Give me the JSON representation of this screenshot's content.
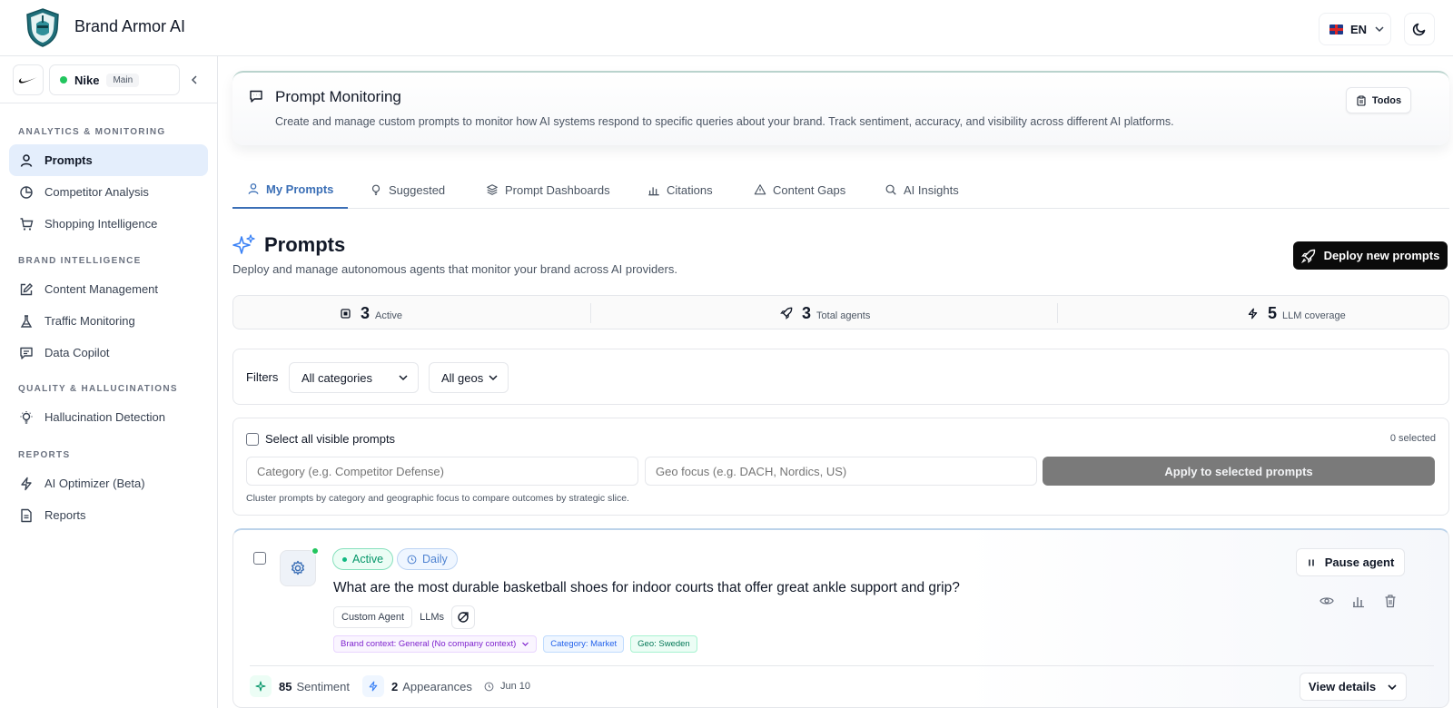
{
  "app": {
    "title": "Brand Armor AI"
  },
  "topbar": {
    "language": "EN",
    "flag_icon": "uk-flag-icon",
    "theme_icon": "moon-icon"
  },
  "org": {
    "name": "Nike",
    "tag": "Main"
  },
  "sidebar": {
    "sections": [
      {
        "title": "ANALYTICS & MONITORING",
        "items": [
          {
            "label": "Prompts",
            "icon": "user-icon",
            "active": true
          },
          {
            "label": "Competitor Analysis",
            "icon": "pie-chart-icon"
          },
          {
            "label": "Shopping Intelligence",
            "icon": "cart-icon"
          }
        ]
      },
      {
        "title": "BRAND INTELLIGENCE",
        "items": [
          {
            "label": "Content Management",
            "icon": "edit-icon"
          },
          {
            "label": "Traffic Monitoring",
            "icon": "flask-icon"
          },
          {
            "label": "Data Copilot",
            "icon": "chat-icon"
          }
        ]
      },
      {
        "title": "QUALITY & HALLUCINATIONS",
        "items": [
          {
            "label": "Hallucination Detection",
            "icon": "lightbulb-icon"
          }
        ]
      },
      {
        "title": "REPORTS",
        "items": [
          {
            "label": "AI Optimizer (Beta)",
            "icon": "bolt-icon"
          },
          {
            "label": "Reports",
            "icon": "document-icon"
          }
        ]
      }
    ]
  },
  "header": {
    "title": "Prompt Monitoring",
    "description": "Create and manage custom prompts to monitor how AI systems respond to specific queries about your brand. Track sentiment, accuracy, and visibility across different AI platforms.",
    "todos_label": "Todos"
  },
  "tabs": [
    {
      "label": "My Prompts",
      "icon": "user-icon",
      "active": true
    },
    {
      "label": "Suggested",
      "icon": "lightbulb-icon"
    },
    {
      "label": "Prompt Dashboards",
      "icon": "layers-icon"
    },
    {
      "label": "Citations",
      "icon": "bar-chart-icon"
    },
    {
      "label": "Content Gaps",
      "icon": "warning-icon"
    },
    {
      "label": "AI Insights",
      "icon": "search-icon"
    }
  ],
  "prompts": {
    "title": "Prompts",
    "subtitle": "Deploy and manage autonomous agents that monitor your brand across AI providers.",
    "deploy_label": "Deploy new prompts"
  },
  "stats": [
    {
      "value": "3",
      "label": "Active",
      "icon": "cpu-icon"
    },
    {
      "value": "3",
      "label": "Total agents",
      "icon": "rocket-icon"
    },
    {
      "value": "5",
      "label": "LLM coverage",
      "icon": "bolt-icon"
    }
  ],
  "filters": {
    "label": "Filters",
    "category": "All categories",
    "geo": "All geos"
  },
  "bulk": {
    "select_all": "Select all visible prompts",
    "selected": "0 selected",
    "category_placeholder": "Category (e.g. Competitor Defense)",
    "geo_placeholder": "Geo focus (e.g. DACH, Nordics, US)",
    "apply": "Apply to selected prompts",
    "hint": "Cluster prompts by category and geographic focus to compare outcomes by strategic slice."
  },
  "agent": {
    "status": "Active",
    "frequency": "Daily",
    "question": "What are the most durable basketball shoes for indoor courts that offer great ankle support and grip?",
    "type": "Custom Agent",
    "llms_label": "LLMs",
    "tags": {
      "brand": "Brand context: General (No company context)",
      "category": "Category: Market",
      "geo": "Geo: Sweden"
    },
    "pause_label": "Pause agent",
    "sentiment_value": "85",
    "sentiment_label": "Sentiment",
    "appearances_value": "2",
    "appearances_label": "Appearances",
    "date": "Jun 10",
    "view_details": "View details"
  },
  "colors": {
    "accent": "#3b6fb6",
    "active_nav_bg": "#e4eefc",
    "success": "#22c55e",
    "deploy_bg": "#0b0b0b",
    "apply_bg": "#7a7a7a"
  }
}
